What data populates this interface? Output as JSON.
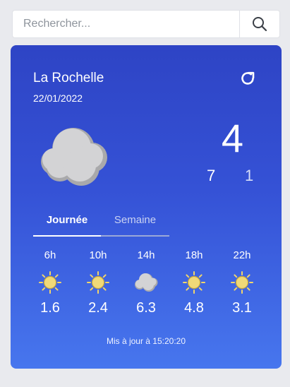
{
  "search": {
    "placeholder": "Rechercher...",
    "icon": "search-icon"
  },
  "weather": {
    "city": "La Rochelle",
    "date": "22/01/2022",
    "main_icon": "cloud-icon",
    "temperature": "4",
    "temp_max": "7",
    "temp_min": "1",
    "colors": {
      "card_top": "#2e44c5",
      "card_bottom": "#4776ee",
      "sun": "#f2d66b",
      "cloud": "#d0d0d0"
    }
  },
  "tabs": [
    {
      "label": "Journée",
      "active": true
    },
    {
      "label": "Semaine",
      "active": false
    }
  ],
  "hourly": [
    {
      "hour": "6h",
      "icon": "sun-icon",
      "value": "1.6"
    },
    {
      "hour": "10h",
      "icon": "sun-icon",
      "value": "2.4"
    },
    {
      "hour": "14h",
      "icon": "cloud-icon",
      "value": "6.3"
    },
    {
      "hour": "18h",
      "icon": "sun-icon",
      "value": "4.8"
    },
    {
      "hour": "22h",
      "icon": "sun-icon",
      "value": "3.1"
    }
  ],
  "updated_text": "Mis à jour à 15:20:20"
}
